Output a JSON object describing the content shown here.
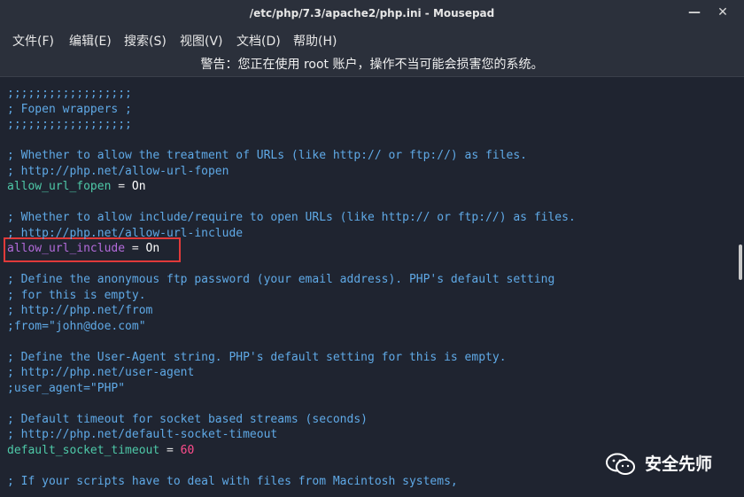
{
  "window": {
    "title": "/etc/php/7.3/apache2/php.ini - Mousepad",
    "minimize_icon": "minimize-icon",
    "close_icon": "close-icon"
  },
  "menu": [
    {
      "label": "文件(F)"
    },
    {
      "label": "编辑(E)"
    },
    {
      "label": "搜索(S)"
    },
    {
      "label": "视图(V)"
    },
    {
      "label": "文档(D)"
    },
    {
      "label": "帮助(H)"
    }
  ],
  "warning": "警告：您正在使用 root 账户，操作不当可能会损害您的系统。",
  "editor": {
    "lines": [
      {
        "text": ";;;;;;;;;;;;;;;;;;",
        "kind": "comment"
      },
      {
        "text": "; Fopen wrappers ;",
        "kind": "comment"
      },
      {
        "text": ";;;;;;;;;;;;;;;;;;",
        "kind": "comment"
      },
      {
        "text": "",
        "kind": "blank"
      },
      {
        "text": "; Whether to allow the treatment of URLs (like http:// or ftp://) as files.",
        "kind": "comment"
      },
      {
        "text": "; http://php.net/allow-url-fopen",
        "kind": "comment"
      },
      {
        "key": "allow_url_fopen",
        "op": " = ",
        "value": "On",
        "kind": "setting"
      },
      {
        "text": "",
        "kind": "blank"
      },
      {
        "text": "; Whether to allow include/require to open URLs (like http:// or ftp://) as files.",
        "kind": "comment"
      },
      {
        "text": "; http://php.net/allow-url-include",
        "kind": "comment"
      },
      {
        "key": "allow_url_include",
        "op": " = ",
        "value": "On",
        "kind": "setting-highlight"
      },
      {
        "text": "",
        "kind": "blank"
      },
      {
        "text": "; Define the anonymous ftp password (your email address). PHP's default setting",
        "kind": "comment"
      },
      {
        "text": "; for this is empty.",
        "kind": "comment"
      },
      {
        "text": "; http://php.net/from",
        "kind": "comment"
      },
      {
        "text": ";from=\"john@doe.com\"",
        "kind": "comment"
      },
      {
        "text": "",
        "kind": "blank"
      },
      {
        "text": "; Define the User-Agent string. PHP's default setting for this is empty.",
        "kind": "comment"
      },
      {
        "text": "; http://php.net/user-agent",
        "kind": "comment"
      },
      {
        "text": ";user_agent=\"PHP\"",
        "kind": "comment"
      },
      {
        "text": "",
        "kind": "blank"
      },
      {
        "text": "; Default timeout for socket based streams (seconds)",
        "kind": "comment"
      },
      {
        "text": "; http://php.net/default-socket-timeout",
        "kind": "comment"
      },
      {
        "key": "default_socket_timeout",
        "op": " = ",
        "value": "60",
        "kind": "setting-number"
      },
      {
        "text": "",
        "kind": "blank"
      },
      {
        "text": "; If your scripts have to deal with files from Macintosh systems,",
        "kind": "comment"
      }
    ]
  },
  "watermark": {
    "text": "安全先师",
    "icon": "wechat-icon"
  },
  "colors": {
    "background": "#1f2430",
    "chrome": "#2b303b",
    "comment": "#5fa9e6",
    "key": "#4ec9a8",
    "key_highlight": "#b36bdb",
    "number": "#ff4d8d",
    "highlight_border": "#e03a3a"
  }
}
